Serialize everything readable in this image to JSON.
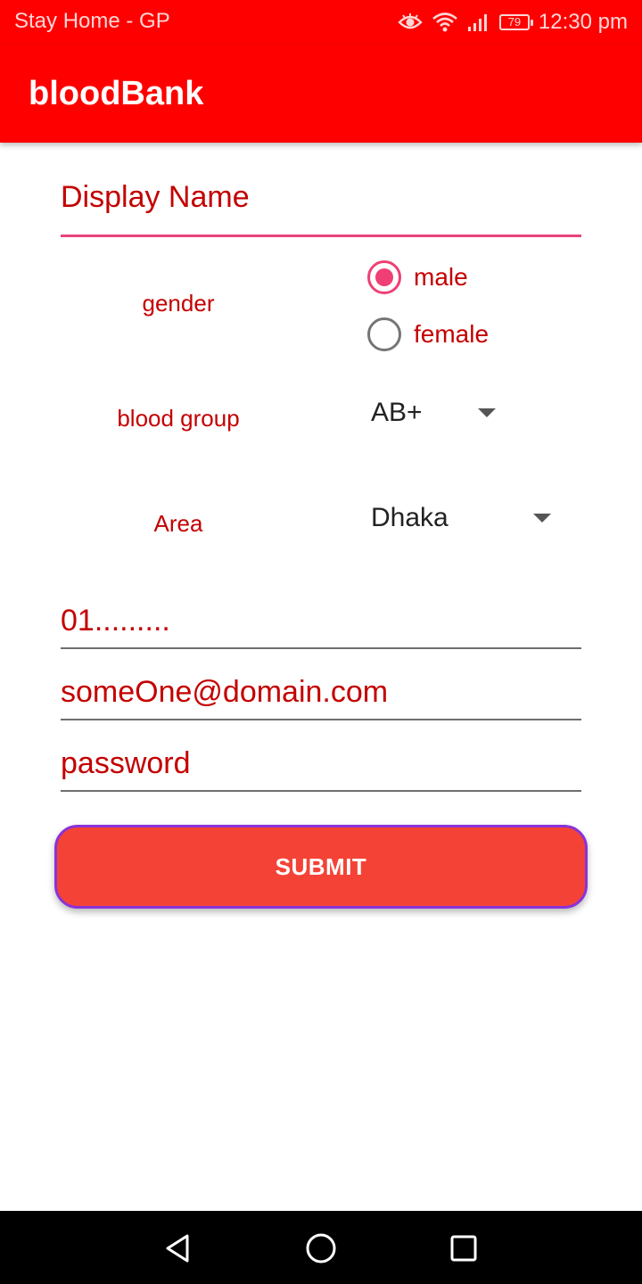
{
  "status_bar": {
    "carrier": "Stay Home - GP",
    "battery": "79",
    "time": "12:30 pm",
    "icons": [
      "eye-icon",
      "wifi-icon",
      "signal-icon",
      "battery-icon"
    ]
  },
  "app_bar": {
    "title": "bloodBank",
    "color": "#ff0000"
  },
  "form": {
    "display_name_placeholder": "Display Name",
    "gender": {
      "label": "gender",
      "options": [
        {
          "label": "male",
          "checked": true
        },
        {
          "label": "female",
          "checked": false
        }
      ]
    },
    "blood_group": {
      "label": "blood group",
      "selected": "AB+"
    },
    "area": {
      "label": "Area",
      "selected": "Dhaka"
    },
    "phone_placeholder": "01.........",
    "email_placeholder": "someOne@domain.com",
    "password_placeholder": "password",
    "submit_label": "SUBMIT",
    "submit_color": "#f44336",
    "accent_color": "#ef3f74",
    "label_color": "#c40000"
  },
  "nav_bar": {
    "icons": [
      "back-icon",
      "home-icon",
      "recents-icon"
    ]
  }
}
